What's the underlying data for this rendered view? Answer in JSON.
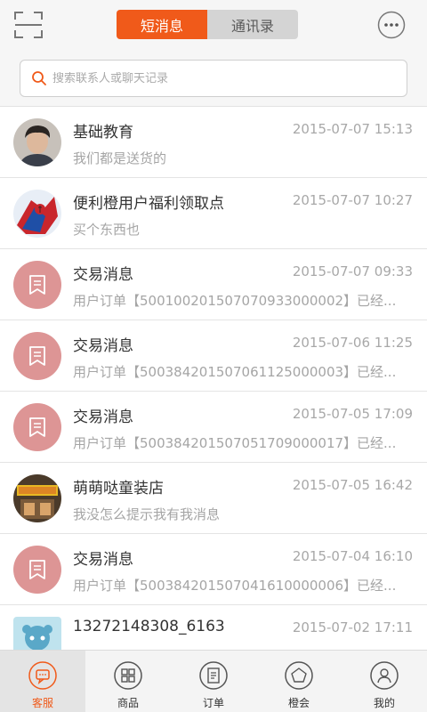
{
  "header": {
    "tabs": [
      {
        "label": "短消息",
        "active": true
      },
      {
        "label": "通讯录",
        "active": false
      }
    ],
    "scan_icon": "scan-icon",
    "more_icon": "more-icon"
  },
  "search": {
    "placeholder": "搜索联系人或聊天记录"
  },
  "conversations": [
    {
      "name": "基础教育",
      "time": "2015-07-07 15:13",
      "preview": "我们都是送货的",
      "avatar": "photo-avatar"
    },
    {
      "name": "便利橙用户福利领取点",
      "time": "2015-07-07 10:27",
      "preview": "买个东西也",
      "avatar": "spiderman-avatar"
    },
    {
      "name": "交易消息",
      "time": "2015-07-07 09:33",
      "preview": "用户订单【500100201507070933000002】已经...",
      "avatar": "message-icon"
    },
    {
      "name": "交易消息",
      "time": "2015-07-06 11:25",
      "preview": "用户订单【500384201507061125000003】已经...",
      "avatar": "message-icon"
    },
    {
      "name": "交易消息",
      "time": "2015-07-05 17:09",
      "preview": "用户订单【500384201507051709000017】已经...",
      "avatar": "message-icon"
    },
    {
      "name": "萌萌哒童装店",
      "time": "2015-07-05 16:42",
      "preview": "我没怎么提示我有我消息",
      "avatar": "shop-avatar"
    },
    {
      "name": "交易消息",
      "time": "2015-07-04 16:10",
      "preview": "用户订单【500384201507041610000006】已经...",
      "avatar": "message-icon"
    },
    {
      "name": "13272148308_6163",
      "time": "2015-07-02 17:11",
      "preview": "",
      "avatar": "cartoon-avatar"
    }
  ],
  "tabbar": {
    "items": [
      {
        "label": "客服",
        "icon": "chat-bubble-icon",
        "active": true
      },
      {
        "label": "商品",
        "icon": "grid-icon",
        "active": false
      },
      {
        "label": "订单",
        "icon": "order-list-icon",
        "active": false
      },
      {
        "label": "橙会",
        "icon": "pentagon-icon",
        "active": false
      },
      {
        "label": "我的",
        "icon": "user-icon",
        "active": false
      }
    ]
  },
  "colors": {
    "accent": "#f05a1a",
    "message_avatar": "#dd9595",
    "header_bg": "#f6f6f6"
  }
}
